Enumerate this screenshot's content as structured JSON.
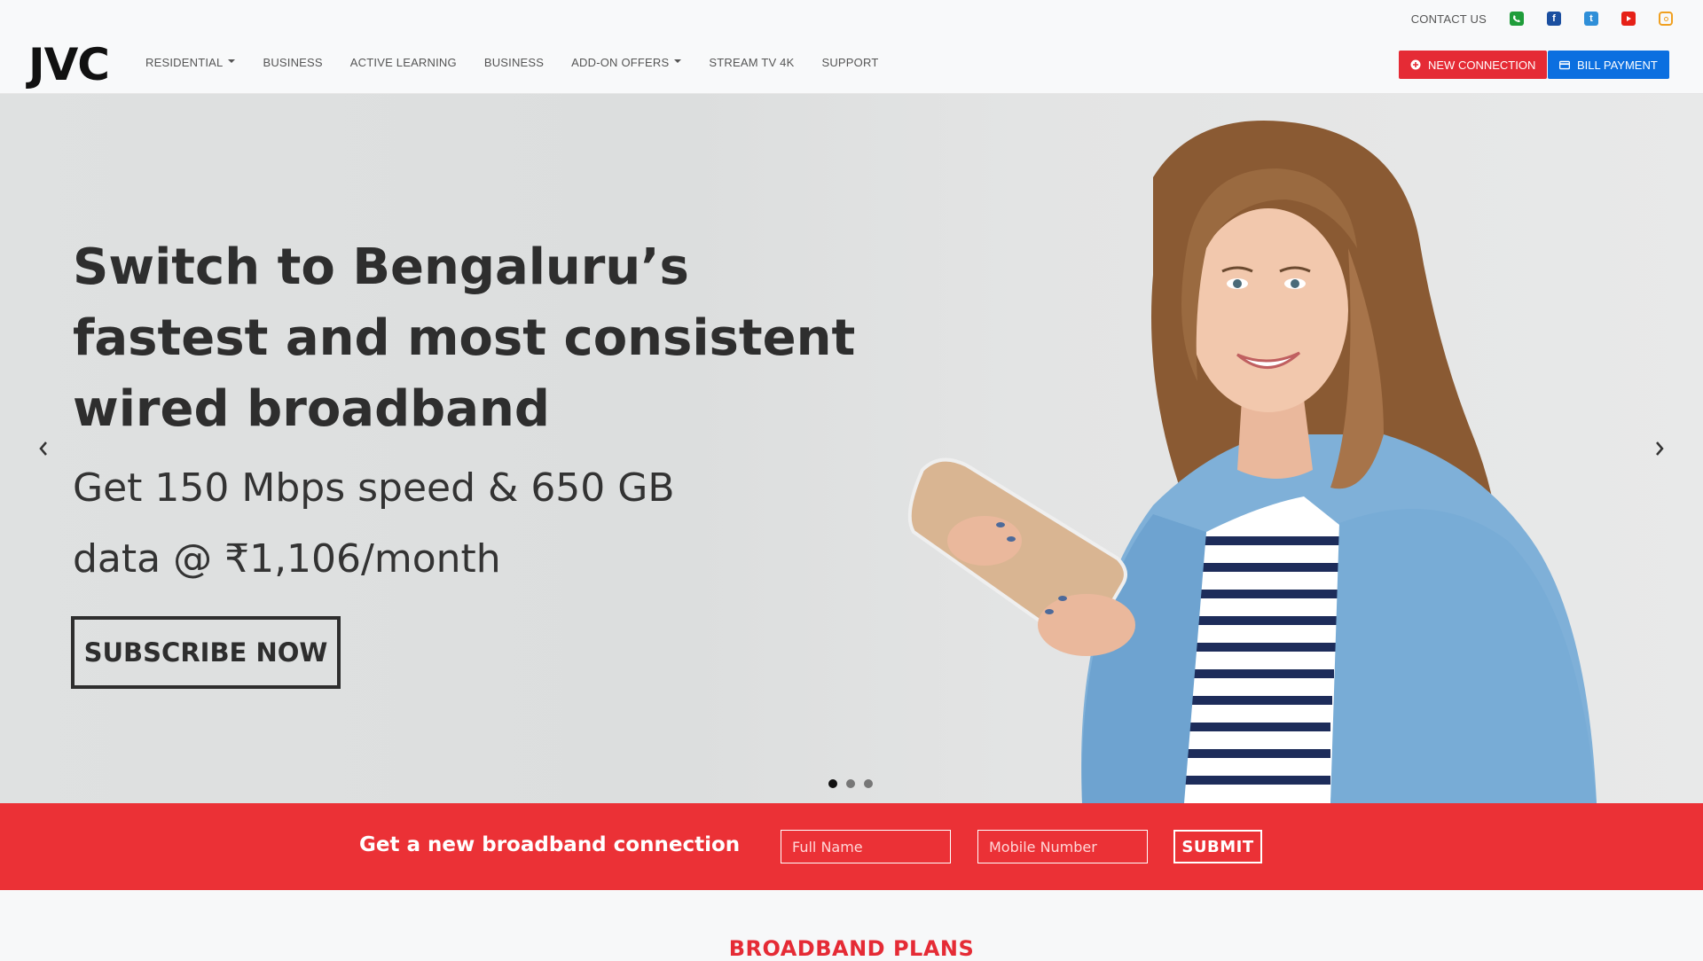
{
  "brand": {
    "logo": "JVC"
  },
  "topbar": {
    "contact_label": "CONTACT US",
    "social_icons": [
      "phone-icon",
      "facebook-icon",
      "twitter-icon",
      "youtube-icon",
      "instagram-icon"
    ]
  },
  "nav": {
    "items": [
      {
        "label": "RESIDENTIAL",
        "dropdown": true
      },
      {
        "label": "BUSINESS",
        "dropdown": false
      },
      {
        "label": "ACTIVE LEARNING",
        "dropdown": false
      },
      {
        "label": "BUSINESS",
        "dropdown": false
      },
      {
        "label": "ADD-ON OFFERS",
        "dropdown": true
      },
      {
        "label": "STREAM TV 4K",
        "dropdown": false
      },
      {
        "label": "SUPPORT",
        "dropdown": false
      }
    ]
  },
  "header_buttons": {
    "new_connection": "NEW CONNECTION",
    "bill_payment": "BILL PAYMENT"
  },
  "hero": {
    "title_line1": "Switch to Bengaluru’s",
    "title_line2": "fastest and most consistent",
    "title_line3": "wired broadband",
    "sub_line1": "Get 150 Mbps speed & 650 GB",
    "sub_line2": "data @ ₹1,106/month",
    "cta": "SUBSCRIBE NOW",
    "slides": 3,
    "active_slide": 1
  },
  "lead_form": {
    "title": "Get a new broadband connection",
    "name_placeholder": "Full Name",
    "mobile_placeholder": "Mobile Number",
    "submit": "SUBMIT"
  },
  "plans": {
    "title": "BROADBAND PLANS"
  },
  "colors": {
    "accent_red": "#e52b35",
    "band_red": "#eb3136",
    "accent_blue": "#0b6fe0",
    "text_dark": "#2e2e2e"
  }
}
